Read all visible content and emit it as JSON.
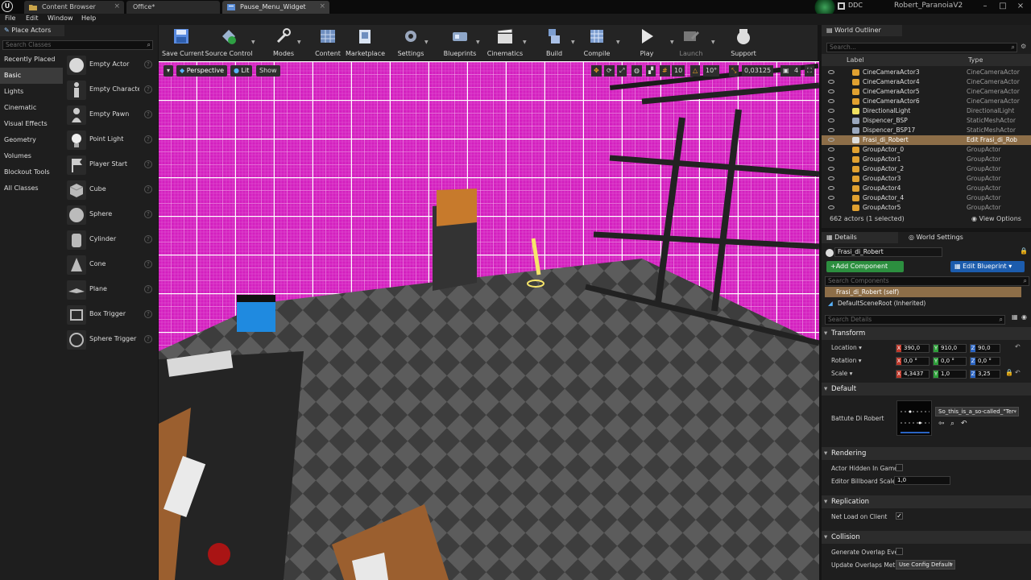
{
  "titlebar": {
    "tabs": [
      {
        "label": "Content Browser"
      },
      {
        "label": "Office*"
      },
      {
        "label": "Pause_Menu_Widget"
      }
    ],
    "ddc": "DDC",
    "project": "Robert_ParanoiaV2"
  },
  "menubar": {
    "items": [
      "File",
      "Edit",
      "Window",
      "Help"
    ]
  },
  "place_actors": {
    "title": "Place Actors",
    "search_placeholder": "Search Classes",
    "categories": [
      "Recently Placed",
      "Basic",
      "Lights",
      "Cinematic",
      "Visual Effects",
      "Geometry",
      "Volumes",
      "Blockout Tools",
      "All Classes"
    ],
    "selected_category": "Basic",
    "actors": [
      "Empty Actor",
      "Empty Characte",
      "Empty Pawn",
      "Point Light",
      "Player Start",
      "Cube",
      "Sphere",
      "Cylinder",
      "Cone",
      "Plane",
      "Box Trigger",
      "Sphere Trigger"
    ]
  },
  "toolbar": {
    "buttons": [
      "Save Current",
      "Source Control",
      "Modes",
      "Content",
      "Marketplace",
      "Settings",
      "Blueprints",
      "Cinematics",
      "Build",
      "Compile",
      "Play",
      "Launch",
      "Support"
    ]
  },
  "viewport": {
    "perspective": "Perspective",
    "lit": "Lit",
    "show": "Show",
    "grid_snap": "10",
    "rot_snap": "10°",
    "scale_snap": "0,03125",
    "camera_speed": "4"
  },
  "outliner": {
    "title": "World Outliner",
    "search_placeholder": "Search...",
    "col_label": "Label",
    "col_type": "Type",
    "rows": [
      {
        "label": "CineCameraActor3",
        "type": "CineCameraActor"
      },
      {
        "label": "CineCameraActor4",
        "type": "CineCameraActor"
      },
      {
        "label": "CineCameraActor5",
        "type": "CineCameraActor"
      },
      {
        "label": "CineCameraActor6",
        "type": "CineCameraActor"
      },
      {
        "label": "DirectionalLight",
        "type": "DirectionalLight"
      },
      {
        "label": "Dispencer_BSP",
        "type": "StaticMeshActor"
      },
      {
        "label": "Dispencer_BSP17",
        "type": "StaticMeshActor"
      },
      {
        "label": "Frasi_di_Robert",
        "type": "Edit Frasi_di_Rob"
      },
      {
        "label": "GroupActor_0",
        "type": "GroupActor"
      },
      {
        "label": "GroupActor1",
        "type": "GroupActor"
      },
      {
        "label": "GroupActor_2",
        "type": "GroupActor"
      },
      {
        "label": "GroupActor3",
        "type": "GroupActor"
      },
      {
        "label": "GroupActor4",
        "type": "GroupActor"
      },
      {
        "label": "GroupActor_4",
        "type": "GroupActor"
      },
      {
        "label": "GroupActor5",
        "type": "GroupActor"
      }
    ],
    "selected_row": 7,
    "status": "662 actors (1 selected)",
    "view_options": "View Options"
  },
  "details": {
    "tab_details": "Details",
    "tab_world": "World Settings",
    "actor_name": "Frasi_di_Robert",
    "add_component": "+Add Component",
    "edit_blueprint": "Edit Blueprint",
    "search_components": "Search Components",
    "self_component": "Frasi_di_Robert (self)",
    "root_component": "DefaultSceneRoot (Inherited)",
    "search_details": "Search Details",
    "transform": {
      "title": "Transform",
      "location_label": "Location",
      "rotation_label": "Rotation",
      "scale_label": "Scale",
      "location": [
        "390,0",
        "910,0",
        "90,0"
      ],
      "rotation": [
        "0,0 °",
        "0,0 °",
        "0,0 °"
      ],
      "scale": [
        "4,3437",
        "1,0",
        "3,25"
      ]
    },
    "default": {
      "title": "Default",
      "battute_label": "Battute Di Robert",
      "battute_value": "So_this_is_a_so-called_\"Ter"
    },
    "rendering": {
      "title": "Rendering",
      "hidden_label": "Actor Hidden In Game",
      "billboard_label": "Editor Billboard Scale",
      "billboard_value": "1,0"
    },
    "replication": {
      "title": "Replication",
      "net_load_label": "Net Load on Client"
    },
    "collision": {
      "title": "Collision",
      "overlap_label": "Generate Overlap Even",
      "update_label": "Update Overlaps Meth",
      "update_value": "Use Config Default"
    }
  },
  "colors": {
    "accent_blue": "#1c5cad",
    "accent_green": "#2c8f3f",
    "selection": "#8d6e48",
    "wall_magenta": "#d41fbf"
  }
}
